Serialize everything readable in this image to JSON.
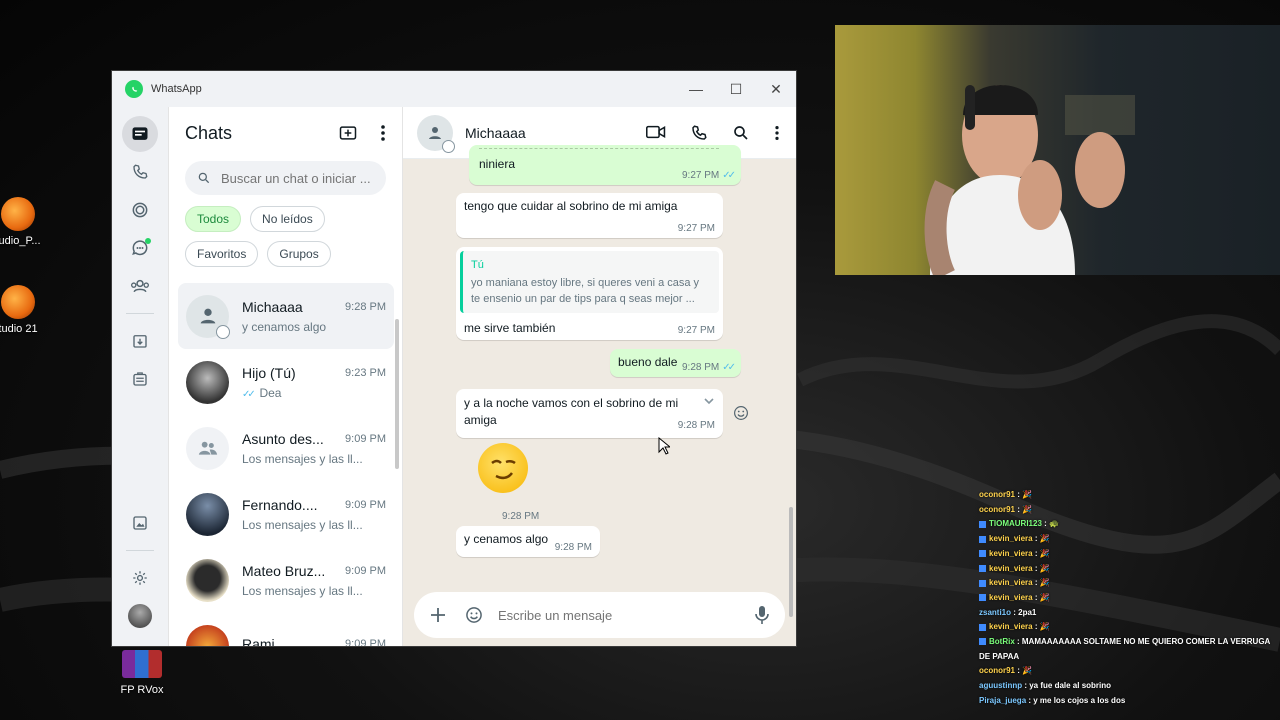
{
  "desktop": {
    "icons": [
      {
        "label": "tudio_P..."
      },
      {
        "label": "tudio 21"
      },
      {
        "label": "FP RVox"
      }
    ]
  },
  "window": {
    "title": "WhatsApp",
    "controls": {
      "minimize": "—",
      "maximize": "☐",
      "close": "✕"
    }
  },
  "rail": {
    "items": [
      "chats-icon",
      "calls-icon",
      "status-icon",
      "channels-icon",
      "communities-icon",
      "archive-icon",
      "briefcase-icon",
      "media-icon",
      "settings-icon",
      "profile-avatar"
    ]
  },
  "chatlist": {
    "title": "Chats",
    "search_placeholder": "Buscar un chat o iniciar ...",
    "filters": [
      "Todos",
      "No leídos",
      "Favoritos",
      "Grupos"
    ],
    "rows": [
      {
        "name": "Michaaaa",
        "time": "9:28 PM",
        "last": "y cenamos algo"
      },
      {
        "name": "Hijo (Tú)",
        "time": "9:23 PM",
        "last": "Dea"
      },
      {
        "name": "Asunto des...",
        "time": "9:09 PM",
        "last": "Los mensajes y las ll..."
      },
      {
        "name": "Fernando....",
        "time": "9:09 PM",
        "last": "Los mensajes y las ll..."
      },
      {
        "name": "Mateo Bruz...",
        "time": "9:09 PM",
        "last": "Los mensajes y las ll..."
      },
      {
        "name": "Rami",
        "time": "9:09 PM",
        "last": ""
      }
    ]
  },
  "conversation": {
    "contact": "Michaaaa",
    "messages": [
      {
        "dir": "out",
        "text": "niniera",
        "time": "9:27 PM"
      },
      {
        "dir": "in",
        "text": "tengo que cuidar al sobrino de mi amiga",
        "time": "9:27 PM"
      },
      {
        "dir": "in",
        "quote_author": "Tú",
        "quote_text": "yo maniana estoy libre, si queres veni a casa y te ensenio un par de tips para q seas mejor ...",
        "text": "me sirve también",
        "time": "9:27 PM"
      },
      {
        "dir": "out",
        "text": "bueno dale",
        "time": "9:28 PM"
      },
      {
        "dir": "in",
        "text": "y a la noche vamos con el sobrino de mi amiga",
        "time": "9:28 PM"
      },
      {
        "dir": "in",
        "text": "",
        "time": "9:28 PM",
        "emoji": "smirk-emoji"
      },
      {
        "dir": "in",
        "text": "y cenamos algo",
        "time": "9:28 PM"
      }
    ],
    "composer_placeholder": "Escribe un mensaje"
  },
  "stream_chat": [
    {
      "user": "oconor91",
      "msg": "🎉",
      "cls": "u"
    },
    {
      "user": "oconor91",
      "msg": "🎉",
      "cls": "u"
    },
    {
      "user": "TIOMAURI123",
      "msg": "🐢",
      "cls": "u g"
    },
    {
      "user": "kevin_viera",
      "msg": "🎉",
      "cls": "u"
    },
    {
      "user": "kevin_viera",
      "msg": "🎉",
      "cls": "u"
    },
    {
      "user": "kevin_viera",
      "msg": "🎉",
      "cls": "u"
    },
    {
      "user": "kevin_viera",
      "msg": "🎉",
      "cls": "u"
    },
    {
      "user": "kevin_viera",
      "msg": "🎉",
      "cls": "u"
    },
    {
      "user": "zsanti1o",
      "msg": "2pa1",
      "cls": "u b"
    },
    {
      "user": "kevin_viera",
      "msg": "🎉",
      "cls": "u"
    },
    {
      "user": "BotRix",
      "msg": "MAMAAAAAAA SOLTAME NO ME QUIERO COMER LA VERRUGA DE PAPAA",
      "cls": "u g"
    },
    {
      "user": "oconor91",
      "msg": "🎉",
      "cls": "u"
    },
    {
      "user": "aguustinnp",
      "msg": "ya fue dale al sobrino",
      "cls": "u b"
    },
    {
      "user": "Piraja_juega",
      "msg": "y me los cojos a los dos",
      "cls": "u b"
    }
  ]
}
